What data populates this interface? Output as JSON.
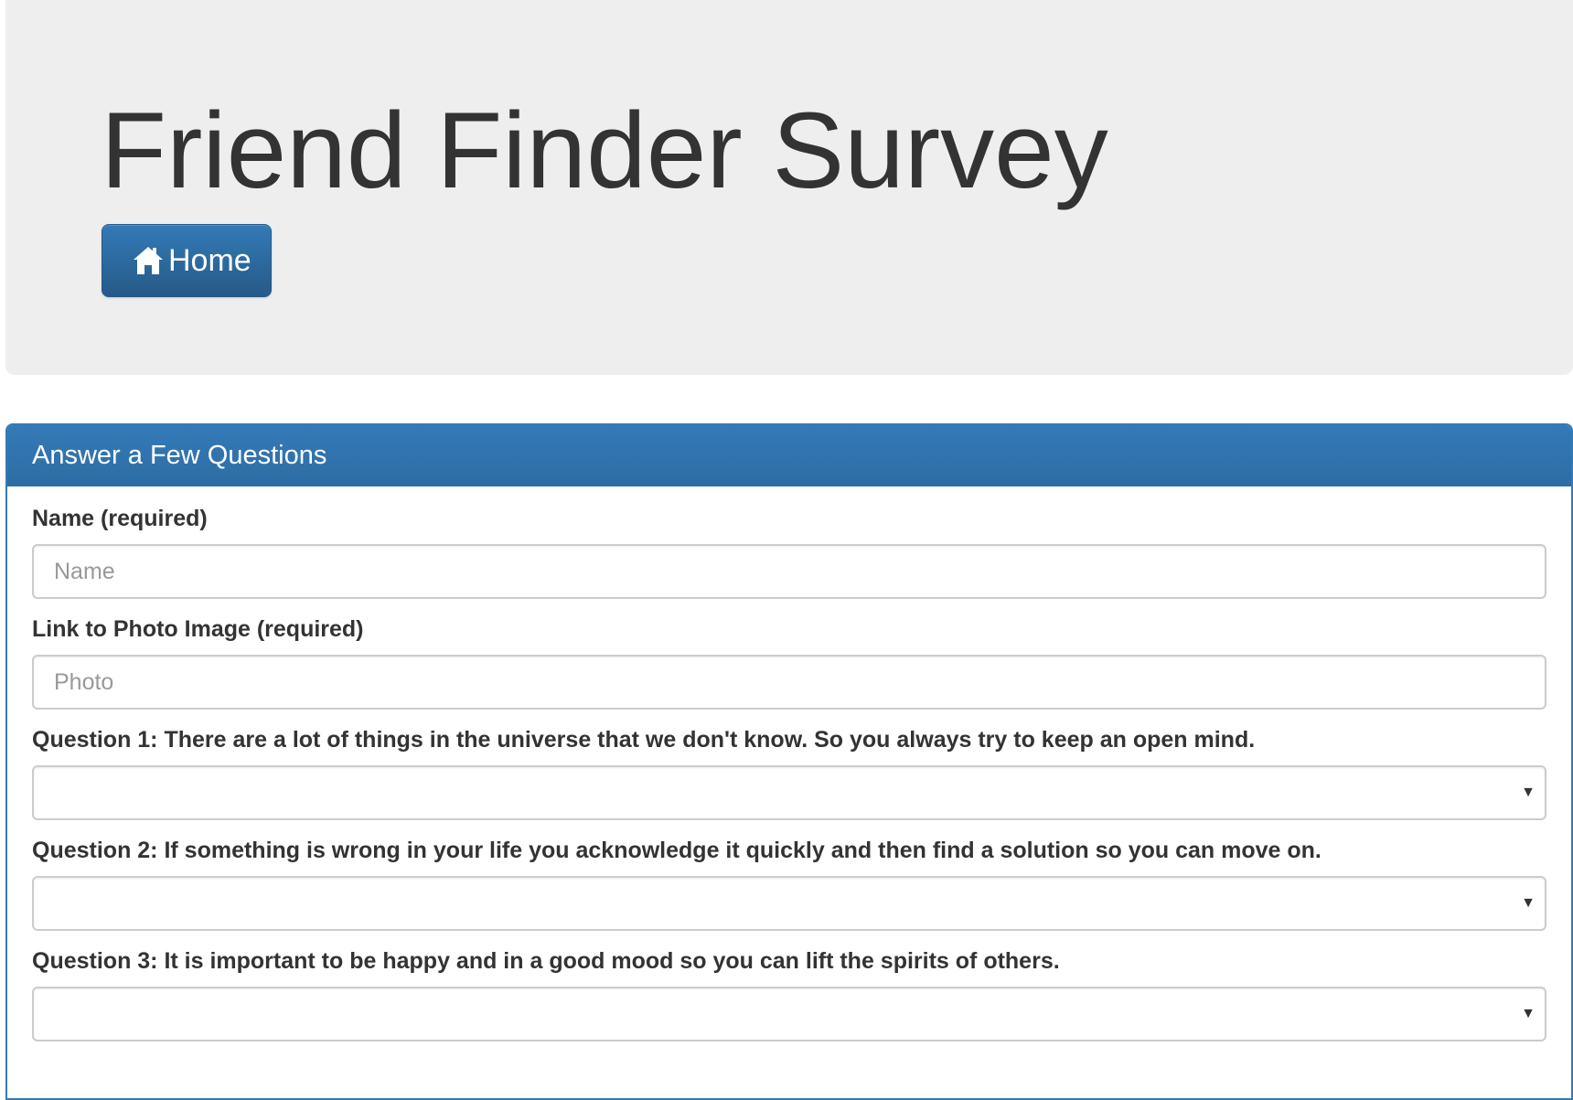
{
  "header": {
    "title": "Friend Finder Survey",
    "home_button": {
      "label": "Home",
      "icon": "home-icon"
    }
  },
  "panel": {
    "heading": "Answer a Few Questions",
    "fields": {
      "name": {
        "label": "Name (required)",
        "placeholder": "Name",
        "value": ""
      },
      "photo": {
        "label": "Link to Photo Image (required)",
        "placeholder": "Photo",
        "value": ""
      }
    },
    "questions": [
      {
        "label": "Question 1: There are a lot of things in the universe that we don't know. So you always try to keep an open mind.",
        "selected": ""
      },
      {
        "label": "Question 2: If something is wrong in your life you acknowledge it quickly and then find a solution so you can move on.",
        "selected": ""
      },
      {
        "label": "Question 3: It is important to be happy and in a good mood so you can lift the spirits of others.",
        "selected": ""
      }
    ]
  },
  "colors": {
    "primary": "#337ab7",
    "primary_dark": "#265a88",
    "jumbotron_bg": "#eeeeee",
    "text": "#333333"
  }
}
